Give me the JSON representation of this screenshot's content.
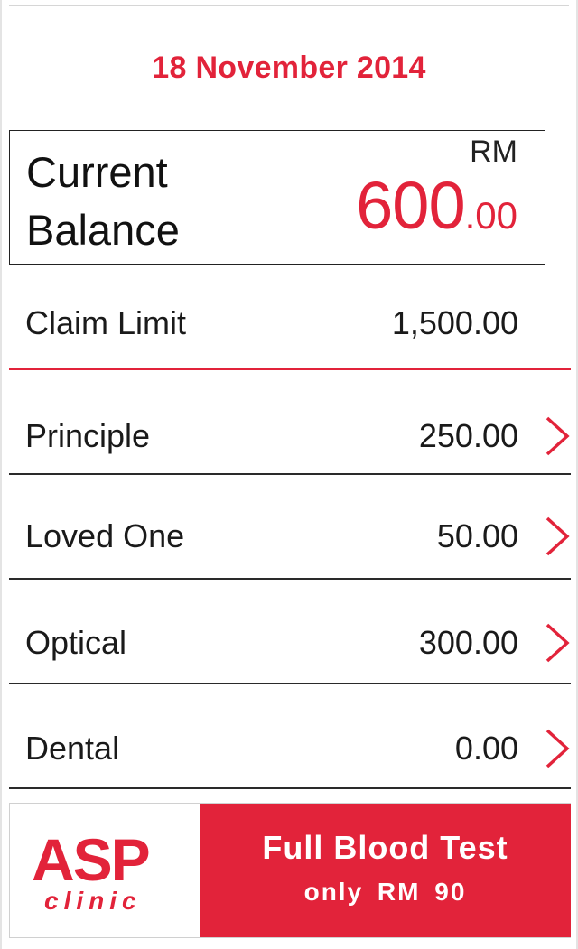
{
  "header": {
    "date": "18 November 2014"
  },
  "balance": {
    "label_line1": "Current",
    "label_line2": "Balance",
    "currency": "RM",
    "amount_integer": "600",
    "amount_decimal": ".00"
  },
  "claim_limit": {
    "label": "Claim Limit",
    "value": "1,500.00"
  },
  "categories": [
    {
      "label": "Principle",
      "value": "250.00"
    },
    {
      "label": "Loved One",
      "value": "50.00"
    },
    {
      "label": "Optical",
      "value": "300.00"
    },
    {
      "label": "Dental",
      "value": "0.00"
    }
  ],
  "banner": {
    "logo_text": "ASP",
    "logo_subtext": "clinic",
    "promo_line1": "Full Blood Test",
    "promo_line2": "only RM 90"
  },
  "colors": {
    "accent": "#e2233a",
    "text": "#1a1a1a",
    "divider": "#2a2a2a"
  },
  "icons": {
    "row_chevron": "chevron-right-icon"
  }
}
